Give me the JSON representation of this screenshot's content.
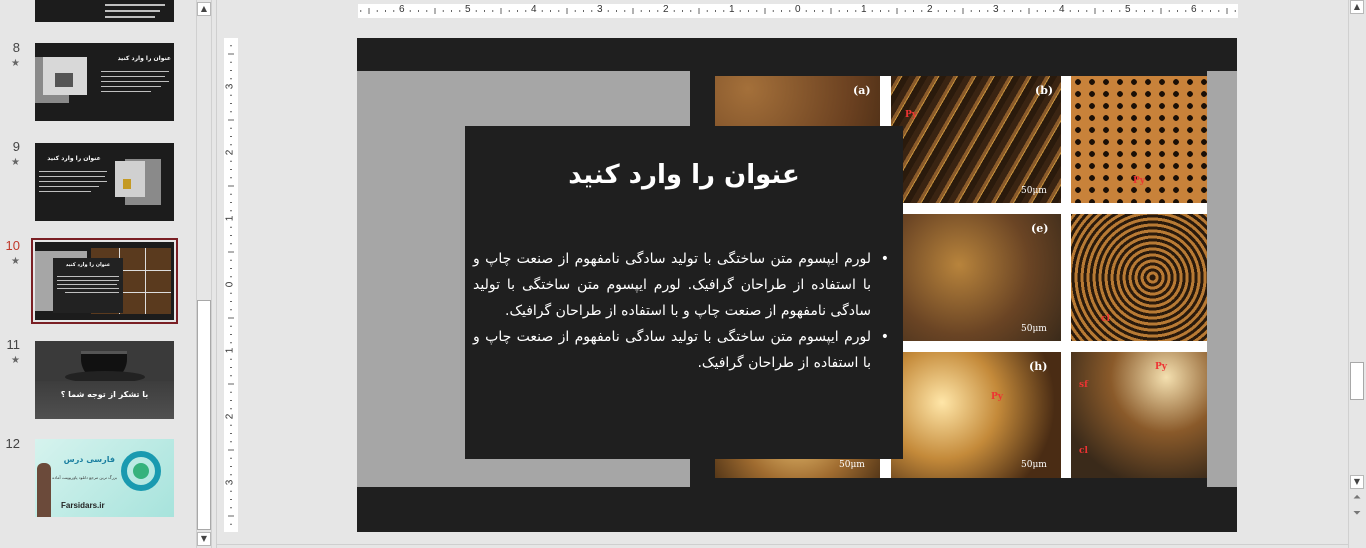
{
  "thumbnails": [
    {
      "num": "8",
      "title": "عنوان را وارد کنید"
    },
    {
      "num": "9",
      "title": "عنوان را وارد کنید"
    },
    {
      "num": "10",
      "title": "عنوان را وارد کنید"
    },
    {
      "num": "11",
      "caption": "با تشکر از توجه شما ؟"
    },
    {
      "num": "12",
      "brand": "فارسی درس",
      "tagline": "بزرگ ترین مرجع دانلود پاورپوینت آماده در ایران",
      "site": "Farsidars.ir"
    }
  ],
  "star_glyph": "★",
  "ruler_h": [
    "6",
    "5",
    "4",
    "3",
    "2",
    "1",
    "0",
    "1",
    "2",
    "3",
    "4",
    "5",
    "6"
  ],
  "ruler_v": [
    "3",
    "2",
    "1",
    "0",
    "1",
    "2",
    "3"
  ],
  "slide": {
    "title": "عنوان را وارد کنید",
    "bullets": [
      "لورم ایپسوم متن ساختگی با تولید سادگی نامفهوم از صنعت چاپ و با استفاده از طراحان گرافیک. لورم ایپسوم متن ساختگی با تولید سادگی نامفهوم از صنعت چاپ و با استفاده از طراحان گرافیک.",
      "لورم ایپسوم متن ساختگی با تولید سادگی نامفهوم از صنعت چاپ و با استفاده از طراحان گرافیک."
    ],
    "bullet_glyph": "•",
    "photo_labels": [
      "(a)",
      "(b)",
      "(e)",
      "(h)"
    ],
    "mineral_labels": [
      "Py",
      "Py",
      "Py",
      "sf",
      "cl",
      "cl",
      "Py"
    ],
    "scale_label": "50μm"
  },
  "colors": {
    "active_num": "#c0392b",
    "active_frame": "#7a1f24",
    "slide_bg": "#1f1f1f",
    "gray_panel": "#a6a6a6"
  }
}
